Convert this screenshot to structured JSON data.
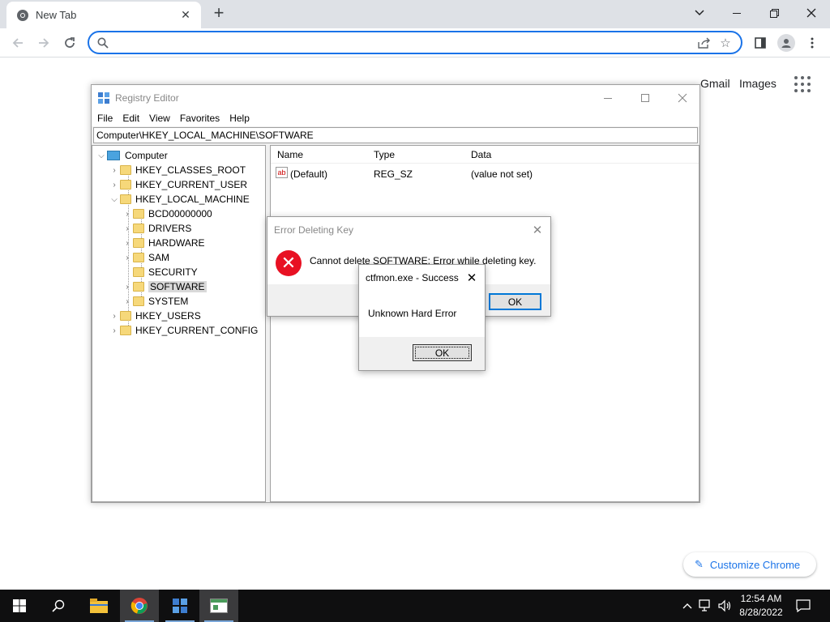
{
  "browser": {
    "tab_title": "New Tab",
    "omnibox_placeholder": ""
  },
  "ntp": {
    "gmail": "Gmail",
    "images": "Images",
    "customize": "Customize Chrome"
  },
  "regedit": {
    "title": "Registry Editor",
    "menu": [
      "File",
      "Edit",
      "View",
      "Favorites",
      "Help"
    ],
    "address": "Computer\\HKEY_LOCAL_MACHINE\\SOFTWARE",
    "tree": {
      "root": "Computer",
      "hives": [
        "HKEY_CLASSES_ROOT",
        "HKEY_CURRENT_USER",
        "HKEY_LOCAL_MACHINE"
      ],
      "hklm_children": [
        "BCD00000000",
        "DRIVERS",
        "HARDWARE",
        "SAM",
        "SECURITY",
        "SOFTWARE",
        "SYSTEM"
      ],
      "hives_after": [
        "HKEY_USERS",
        "HKEY_CURRENT_CONFIG"
      ],
      "selected": "SOFTWARE"
    },
    "columns": [
      "Name",
      "Type",
      "Data"
    ],
    "rows": [
      {
        "name": "(Default)",
        "type": "REG_SZ",
        "data": "(value not set)"
      }
    ]
  },
  "error_dialog": {
    "title": "Error Deleting Key",
    "message": "Cannot delete SOFTWARE:  Error while deleting key.",
    "ok": "OK"
  },
  "ctfmon_dialog": {
    "title": "ctfmon.exe - Success",
    "message": "Unknown Hard Error",
    "ok": "OK"
  },
  "taskbar": {
    "time": "12:54 AM",
    "date": "8/28/2022"
  },
  "colors": {
    "chrome_accent": "#1a73e8",
    "error_red": "#e81123",
    "taskbar_bg": "#0f0f10"
  }
}
